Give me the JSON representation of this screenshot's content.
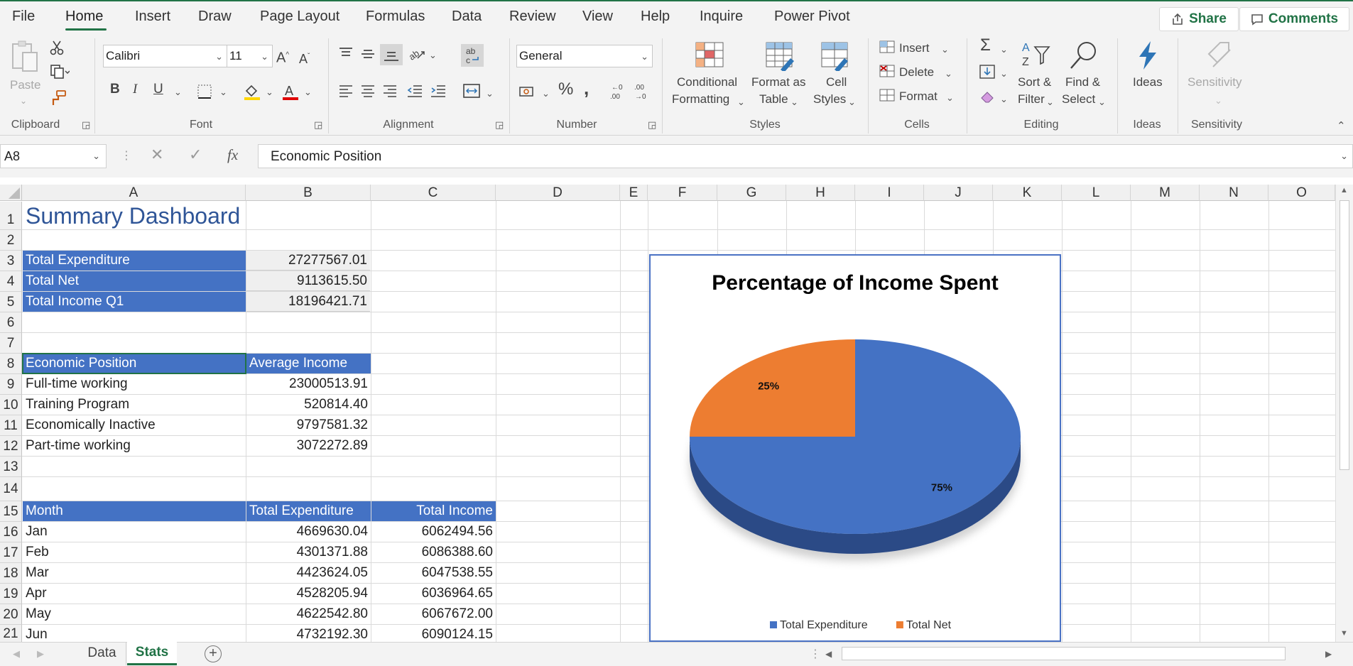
{
  "menu": {
    "items": [
      "File",
      "Home",
      "Insert",
      "Draw",
      "Page Layout",
      "Formulas",
      "Data",
      "Review",
      "View",
      "Help",
      "Inquire",
      "Power Pivot"
    ],
    "active": "Home",
    "share_label": "Share",
    "comments_label": "Comments"
  },
  "ribbon": {
    "clipboard": {
      "paste": "Paste",
      "label": "Clipboard"
    },
    "font": {
      "name": "Calibri",
      "size": "11",
      "label": "Font",
      "bold": "B",
      "italic": "I",
      "underline": "U"
    },
    "alignment": {
      "label": "Alignment"
    },
    "number": {
      "format": "General",
      "label": "Number",
      "percent": "%",
      "comma": ","
    },
    "styles": {
      "conditional_1": "Conditional",
      "conditional_2": "Formatting",
      "format_table_1": "Format as",
      "format_table_2": "Table",
      "cell_styles_1": "Cell",
      "cell_styles_2": "Styles",
      "label": "Styles"
    },
    "cells": {
      "insert": "Insert",
      "delete": "Delete",
      "format": "Format",
      "label": "Cells"
    },
    "editing": {
      "sort_1": "Sort &",
      "sort_2": "Filter",
      "find_1": "Find &",
      "find_2": "Select",
      "label": "Editing"
    },
    "ideas": {
      "button": "Ideas",
      "label": "Ideas"
    },
    "sensitivity": {
      "button": "Sensitivity",
      "label": "Sensitivity"
    }
  },
  "formula_bar": {
    "name_box": "A8",
    "fx": "fx",
    "content": "Economic Position"
  },
  "columns": [
    "A",
    "B",
    "C",
    "D",
    "E",
    "F",
    "G",
    "H",
    "I",
    "J",
    "K",
    "L",
    "M",
    "N",
    "O"
  ],
  "rows": [
    "1",
    "2",
    "3",
    "4",
    "5",
    "6",
    "7",
    "8",
    "9",
    "10",
    "11",
    "12",
    "13",
    "14",
    "15",
    "16",
    "17",
    "18",
    "19",
    "20",
    "21"
  ],
  "sheet": {
    "title": "Summary Dashboard",
    "summary": [
      {
        "label": "Total Expenditure",
        "value": "27277567.01"
      },
      {
        "label": "Total Net",
        "value": "9113615.50"
      },
      {
        "label": "Total Income Q1",
        "value": "18196421.71"
      }
    ],
    "position_header": {
      "a": "Economic Position",
      "b": "Average Income"
    },
    "positions": [
      {
        "label": "Full-time working",
        "value": "23000513.91"
      },
      {
        "label": "Training Program",
        "value": "520814.40"
      },
      {
        "label": "Economically Inactive",
        "value": "9797581.32"
      },
      {
        "label": "Part-time working",
        "value": "3072272.89"
      }
    ],
    "month_header": {
      "a": "Month",
      "b": "Total Expenditure",
      "c": "Total Income"
    },
    "months": [
      {
        "month": "Jan",
        "exp": "4669630.04",
        "inc": "6062494.56"
      },
      {
        "month": "Feb",
        "exp": "4301371.88",
        "inc": "6086388.60"
      },
      {
        "month": "Mar",
        "exp": "4423624.05",
        "inc": "6047538.55"
      },
      {
        "month": "Apr",
        "exp": "4528205.94",
        "inc": "6036964.65"
      },
      {
        "month": "May",
        "exp": "4622542.80",
        "inc": "6067672.00"
      },
      {
        "month": "Jun",
        "exp": "4732192.30",
        "inc": "6090124.15"
      }
    ]
  },
  "chart_data": {
    "type": "pie",
    "title": "Percentage of Income Spent",
    "categories": [
      "Total Expenditure",
      "Total Net"
    ],
    "values": [
      75,
      25
    ],
    "data_labels": [
      "75%",
      "25%"
    ],
    "colors": [
      "#4472c4",
      "#ed7d31"
    ],
    "legend": "bottom",
    "style": "3d"
  },
  "tabs": {
    "items": [
      "Data",
      "Stats"
    ],
    "active": "Stats"
  }
}
